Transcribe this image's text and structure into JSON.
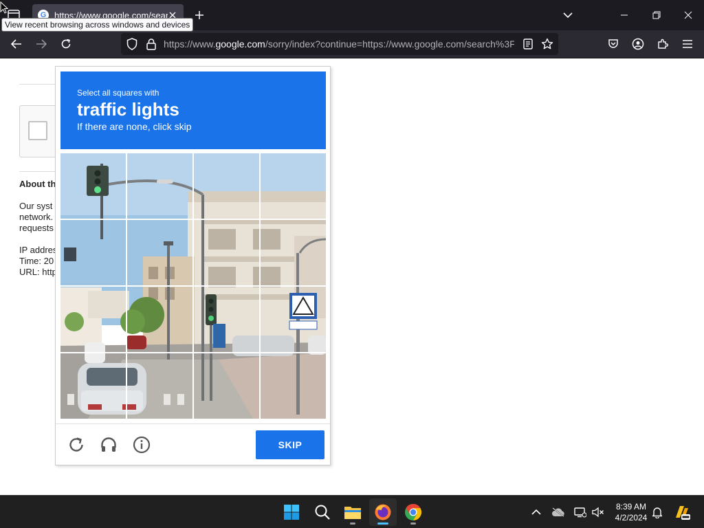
{
  "browser": {
    "tab": {
      "title": "https://www.google.com/search",
      "favicon": "G"
    },
    "tooltip": "View recent browsing across windows and devices",
    "url": {
      "prefix": "https://www.",
      "host": "google.com",
      "rest": "/sorry/index?continue=https://www.google.com/search%3F"
    }
  },
  "page": {
    "about_title": "About th",
    "lines": [
      "Our syst",
      "network.",
      "requests",
      "IP addres",
      "Time: 20",
      "URL: http"
    ]
  },
  "challenge": {
    "instruction": "Select all squares with",
    "object": "traffic lights",
    "hint": "If there are none, click skip",
    "skip_label": "SKIP"
  },
  "taskbar": {
    "time": "8:39 AM",
    "date": "4/2/2024"
  },
  "colors": {
    "accent": "#1a73e8",
    "titlebar": "#1c1b22",
    "navbar": "#2b2a33",
    "taskbar": "#202020"
  }
}
